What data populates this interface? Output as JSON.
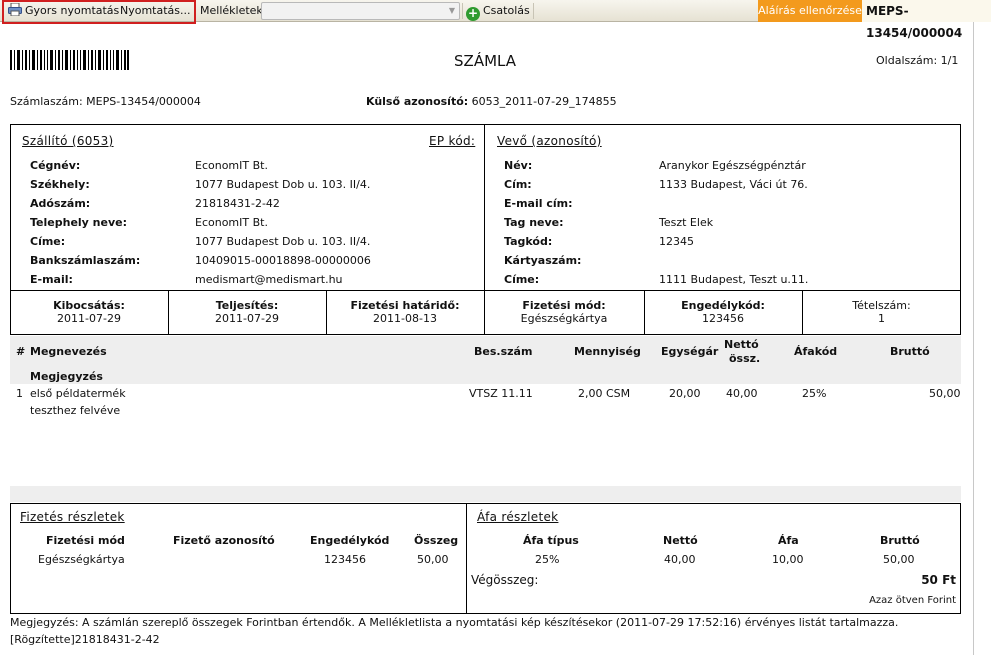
{
  "toolbar": {
    "quick_print": "Gyors nyomtatás",
    "print": "Nyomtatás...",
    "attachments_label": "Mellékletek:",
    "attachments_value": "",
    "attach": "Csatolás",
    "signature_check": "Aláírás ellenőrzése",
    "document_id": "MEPS-13454/000004"
  },
  "doc": {
    "title": "SZÁMLA",
    "page_no": "Oldalszám: 1/1",
    "invoice_no": "Számlaszám: MEPS-13454/000004",
    "external_id_label": "Külső azonosító:",
    "external_id": "6053_2011-07-29_174855"
  },
  "supplier": {
    "title": "Szállító (6053)",
    "ep_code": "EP kód:",
    "rows": [
      {
        "label": "Cégnév:",
        "value": "EconomIT Bt."
      },
      {
        "label": "Székhely:",
        "value": "1077 Budapest Dob u. 103. II/4."
      },
      {
        "label": "Adószám:",
        "value": "21818431-2-42"
      },
      {
        "label": "Telephely neve:",
        "value": "EconomIT Bt."
      },
      {
        "label": "Címe:",
        "value": "1077 Budapest Dob u. 103. II/4."
      },
      {
        "label": "Bankszámlaszám:",
        "value": "10409015-00018898-00000006"
      },
      {
        "label": "E-mail:",
        "value": "medismart@medismart.hu"
      }
    ]
  },
  "buyer": {
    "title": "Vevő (azonosító)",
    "rows": [
      {
        "label": "Név:",
        "value": "Aranykor Egészségpénztár"
      },
      {
        "label": "Cím:",
        "value": "1133 Budapest, Váci út 76."
      },
      {
        "label": "E-mail cím:",
        "value": ""
      },
      {
        "label": "Tag neve:",
        "value": "Teszt Elek"
      },
      {
        "label": "Tagkód:",
        "value": "12345"
      },
      {
        "label": "Kártyaszám:",
        "value": ""
      },
      {
        "label": "Címe:",
        "value": "1111 Budapest, Teszt u.11."
      }
    ]
  },
  "dates": [
    {
      "label": "Kibocsátás:",
      "value": "2011-07-29"
    },
    {
      "label": "Teljesítés:",
      "value": "2011-07-29"
    },
    {
      "label": "Fizetési határidő:",
      "value": "2011-08-13"
    },
    {
      "label": "Fizetési mód:",
      "value": "Egészségkártya"
    },
    {
      "label": "Engedélykód:",
      "value": "123456"
    },
    {
      "label": "Tételszám:",
      "value": "1"
    }
  ],
  "items_table": {
    "headers": {
      "num": "#",
      "name": "Megnevezés",
      "note": "Megjegyzés",
      "code": "Bes.szám",
      "qty": "Mennyiség",
      "unit": "Egységár",
      "net1": "Nettó",
      "net2": "össz.",
      "vat": "Áfakód",
      "gross": "Bruttó"
    },
    "rows": [
      {
        "num": "1",
        "name1": "első példatermék",
        "name2": "teszthez felvéve",
        "code": "VTSZ 11.11",
        "qty": "2,00 CSM",
        "unit": "20,00",
        "net": "40,00",
        "vat": "25%",
        "gross": "50,00"
      }
    ]
  },
  "payment": {
    "title": "Fizetés részletek",
    "headers": [
      "Fizetési mód",
      "Fizető azonosító",
      "Engedélykód",
      "Összeg"
    ],
    "row": [
      "Egészségkártya",
      "",
      "123456",
      "50,00"
    ]
  },
  "vat_details": {
    "title": "Áfa részletek",
    "headers": [
      "Áfa típus",
      "Nettó",
      "Áfa",
      "Bruttó"
    ],
    "row": [
      "25%",
      "40,00",
      "10,00",
      "50,00"
    ],
    "total_label": "Végösszeg:",
    "total_value": "50 Ft",
    "total_words": "Azaz ötven Forint"
  },
  "footer": {
    "note": "Megjegyzés: A számlán szereplő összegek Forintban értendők. A Mellékletlista a nyomtatási kép készítésekor (2011-07-29 17:52:16) érvényes listát tartalmazza.",
    "recorded": "[Rögzítette]21818431-2-42"
  }
}
